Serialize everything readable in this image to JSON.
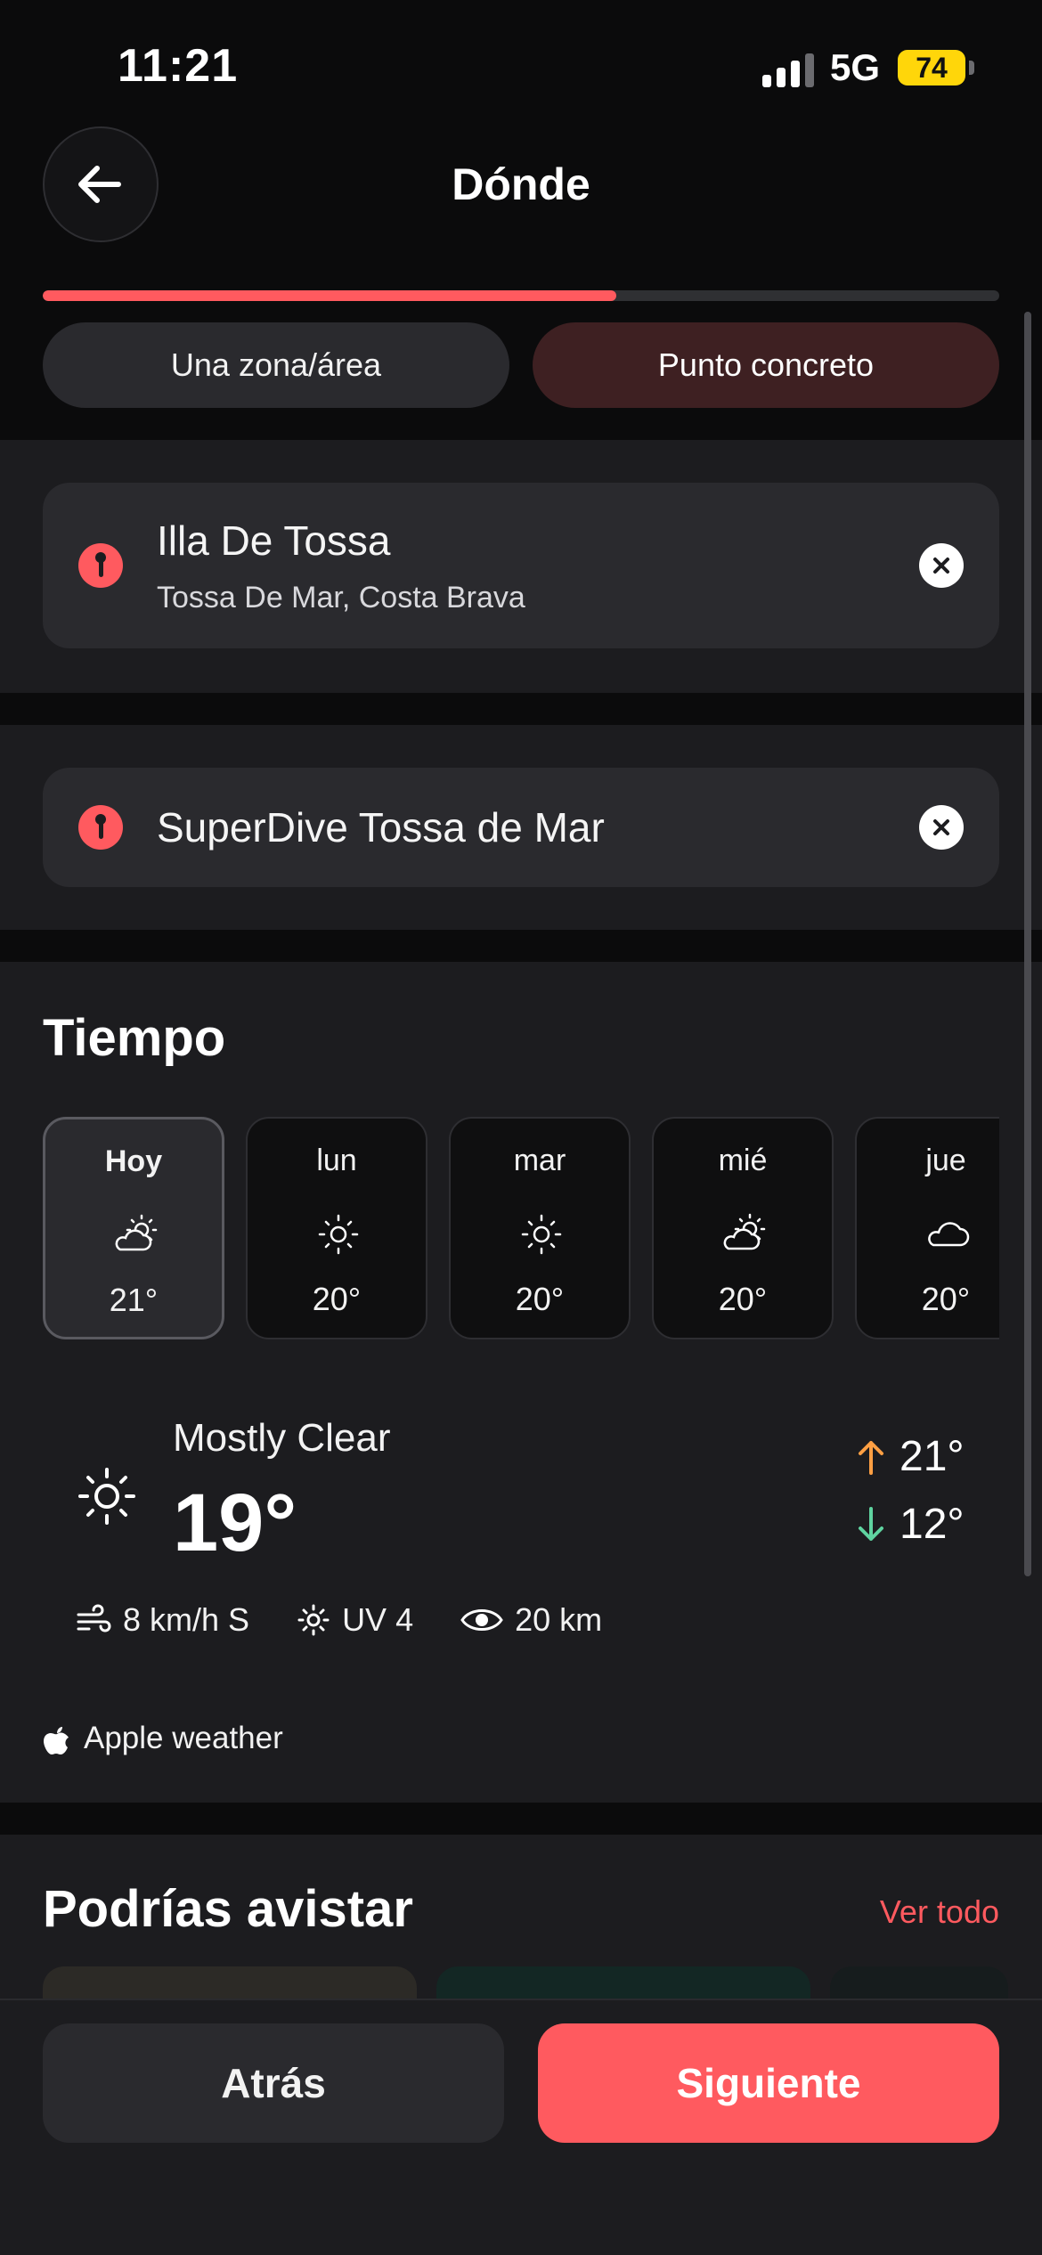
{
  "status_bar": {
    "time": "11:21",
    "network": "5G",
    "battery": "74"
  },
  "header": {
    "title": "Dónde",
    "back_icon": "arrow-left-icon"
  },
  "progress": {
    "fraction": 0.6
  },
  "mode_tabs": [
    {
      "label": "Una zona/área",
      "selected": false
    },
    {
      "label": "Punto concreto",
      "selected": true
    }
  ],
  "location": {
    "title": "Illa De Tossa",
    "subtitle": "Tossa De Mar, Costa Brava"
  },
  "dive_center": {
    "title": "SuperDive Tossa de Mar"
  },
  "weather": {
    "title": "Tiempo",
    "days": [
      {
        "name": "Hoy",
        "icon": "partly-cloudy-icon",
        "temp": "21°"
      },
      {
        "name": "lun",
        "icon": "sun-icon",
        "temp": "20°"
      },
      {
        "name": "mar",
        "icon": "sun-icon",
        "temp": "20°"
      },
      {
        "name": "mié",
        "icon": "partly-cloudy-icon",
        "temp": "20°"
      },
      {
        "name": "jue",
        "icon": "cloud-icon",
        "temp": "20°"
      }
    ],
    "condition": "Mostly Clear",
    "current_temp": "19°",
    "high": "21°",
    "low": "12°",
    "wind": "8 km/h S",
    "uv": "UV 4",
    "visibility": "20 km",
    "credit": "Apple weather",
    "colors": {
      "high_arrow": "#ff9f43",
      "low_arrow": "#5fd3a0"
    }
  },
  "sightings": {
    "title": "Podrías avistar",
    "see_all": "Ver todo"
  },
  "footer": {
    "back_label": "Atrás",
    "next_label": "Siguiente"
  },
  "accent": "#ff5a5f"
}
